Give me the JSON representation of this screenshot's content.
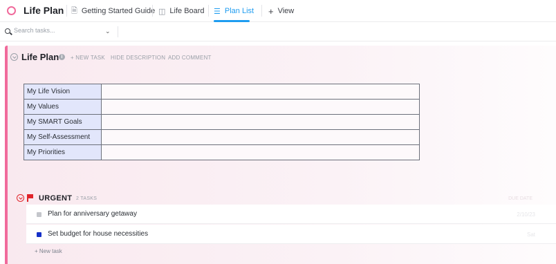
{
  "app": {
    "title": "Life Plan",
    "space_icon": "circle-icon",
    "colors": {
      "accent": "#f06a9b",
      "active_tab": "#1e9cf0",
      "urgent": "#e0242b"
    }
  },
  "tabs": [
    {
      "label": "Getting Started Guide",
      "icon": "doc-icon"
    },
    {
      "label": "Life Board",
      "icon": "board-icon"
    },
    {
      "label": "Plan List",
      "icon": "list-icon",
      "active": true
    },
    {
      "label": "View",
      "icon": "plus-icon"
    }
  ],
  "search": {
    "placeholder": "Search tasks..."
  },
  "list": {
    "title": "Life Plan",
    "actions": {
      "new_task": "+ NEW TASK",
      "hide_description": "HIDE DESCRIPTION",
      "add_comment": "ADD COMMENT"
    },
    "description_rows": [
      {
        "label": "My Life Vision",
        "value": ""
      },
      {
        "label": "My Values",
        "value": ""
      },
      {
        "label": "My SMART Goals",
        "value": ""
      },
      {
        "label": "My Self-Assessment",
        "value": ""
      },
      {
        "label": "My Priorities",
        "value": ""
      }
    ]
  },
  "group": {
    "name": "URGENT",
    "count": "2 TASKS",
    "column_header": "DUE DATE",
    "tasks": [
      {
        "name": "Plan for anniversary getaway",
        "status_color": "#c4c6cb",
        "due": "2/10/23"
      },
      {
        "name": "Set budget for house necessities",
        "status_color": "#1530c8",
        "due": "Sat"
      }
    ],
    "new_task": "+ New task"
  }
}
